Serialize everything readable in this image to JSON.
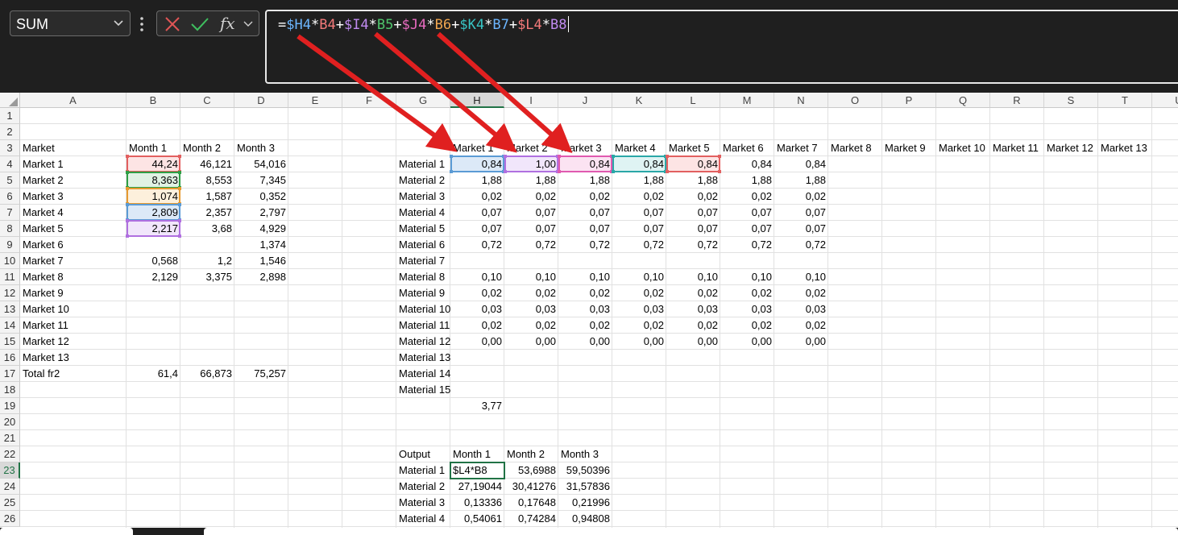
{
  "name_box": {
    "value": "SUM"
  },
  "formula_bar": {
    "fx_label": "fx",
    "tokens": [
      {
        "text": "=",
        "color": "#ffffff"
      },
      {
        "text": "$H4",
        "color": "#6cb6ff"
      },
      {
        "text": "*",
        "color": "#ffffff"
      },
      {
        "text": "B4",
        "color": "#f47a7a"
      },
      {
        "text": "+",
        "color": "#ffffff"
      },
      {
        "text": "$I4",
        "color": "#c08bf0"
      },
      {
        "text": "*",
        "color": "#ffffff"
      },
      {
        "text": "B5",
        "color": "#4fc66c"
      },
      {
        "text": "+",
        "color": "#ffffff"
      },
      {
        "text": "$J4",
        "color": "#e86bc0"
      },
      {
        "text": "*",
        "color": "#ffffff"
      },
      {
        "text": "B6",
        "color": "#f0a650"
      },
      {
        "text": "+",
        "color": "#ffffff"
      },
      {
        "text": "$K4",
        "color": "#38c4c4"
      },
      {
        "text": "*",
        "color": "#ffffff"
      },
      {
        "text": "B7",
        "color": "#6cb6ff"
      },
      {
        "text": "+",
        "color": "#ffffff"
      },
      {
        "text": "$L4",
        "color": "#f47a7a"
      },
      {
        "text": "*",
        "color": "#ffffff"
      },
      {
        "text": "B8",
        "color": "#c08bf0"
      }
    ]
  },
  "columns": [
    "A",
    "B",
    "C",
    "D",
    "E",
    "F",
    "G",
    "H",
    "I",
    "J",
    "K",
    "L",
    "M",
    "N",
    "O",
    "P",
    "Q",
    "R",
    "S",
    "T",
    "U"
  ],
  "selected_column": "H",
  "selected_row": 23,
  "rows": [
    "1",
    "2",
    "3",
    "4",
    "5",
    "6",
    "7",
    "8",
    "9",
    "10",
    "11",
    "12",
    "13",
    "14",
    "15",
    "16",
    "17",
    "18",
    "19",
    "20",
    "21",
    "22",
    "23",
    "24",
    "25",
    "26"
  ],
  "cells": [
    {
      "ref": "A3",
      "text": "Market"
    },
    {
      "ref": "B3",
      "text": "Month 1"
    },
    {
      "ref": "C3",
      "text": "Month 2"
    },
    {
      "ref": "D3",
      "text": "Month 3"
    },
    {
      "ref": "A4",
      "text": "Market 1"
    },
    {
      "ref": "B4",
      "text": "44,24",
      "num": true
    },
    {
      "ref": "C4",
      "text": "46,121",
      "num": true
    },
    {
      "ref": "D4",
      "text": "54,016",
      "num": true
    },
    {
      "ref": "A5",
      "text": "Market 2"
    },
    {
      "ref": "B5",
      "text": "8,363",
      "num": true
    },
    {
      "ref": "C5",
      "text": "8,553",
      "num": true
    },
    {
      "ref": "D5",
      "text": "7,345",
      "num": true
    },
    {
      "ref": "A6",
      "text": "Market 3"
    },
    {
      "ref": "B6",
      "text": "1,074",
      "num": true
    },
    {
      "ref": "C6",
      "text": "1,587",
      "num": true
    },
    {
      "ref": "D6",
      "text": "0,352",
      "num": true
    },
    {
      "ref": "A7",
      "text": "Market 4"
    },
    {
      "ref": "B7",
      "text": "2,809",
      "num": true
    },
    {
      "ref": "C7",
      "text": "2,357",
      "num": true
    },
    {
      "ref": "D7",
      "text": "2,797",
      "num": true
    },
    {
      "ref": "A8",
      "text": "Market 5"
    },
    {
      "ref": "B8",
      "text": "2,217",
      "num": true
    },
    {
      "ref": "C8",
      "text": "3,68",
      "num": true
    },
    {
      "ref": "D8",
      "text": "4,929",
      "num": true
    },
    {
      "ref": "A9",
      "text": "Market 6"
    },
    {
      "ref": "D9",
      "text": "1,374",
      "num": true
    },
    {
      "ref": "A10",
      "text": "Market 7"
    },
    {
      "ref": "B10",
      "text": "0,568",
      "num": true
    },
    {
      "ref": "C10",
      "text": "1,2",
      "num": true
    },
    {
      "ref": "D10",
      "text": "1,546",
      "num": true
    },
    {
      "ref": "A11",
      "text": "Market 8"
    },
    {
      "ref": "B11",
      "text": "2,129",
      "num": true
    },
    {
      "ref": "C11",
      "text": "3,375",
      "num": true
    },
    {
      "ref": "D11",
      "text": "2,898",
      "num": true
    },
    {
      "ref": "A12",
      "text": "Market 9"
    },
    {
      "ref": "A13",
      "text": "Market 10"
    },
    {
      "ref": "A14",
      "text": "Market 11"
    },
    {
      "ref": "A15",
      "text": "Market 12"
    },
    {
      "ref": "A16",
      "text": "Market 13"
    },
    {
      "ref": "A17",
      "text": "Total fr2"
    },
    {
      "ref": "B17",
      "text": "61,4",
      "num": true
    },
    {
      "ref": "C17",
      "text": "66,873",
      "num": true
    },
    {
      "ref": "D17",
      "text": "75,257",
      "num": true
    },
    {
      "ref": "H3",
      "text": "Market 1"
    },
    {
      "ref": "I3",
      "text": "Market 2"
    },
    {
      "ref": "J3",
      "text": "Market 3"
    },
    {
      "ref": "K3",
      "text": "Market 4"
    },
    {
      "ref": "L3",
      "text": "Market 5"
    },
    {
      "ref": "M3",
      "text": "Market 6"
    },
    {
      "ref": "N3",
      "text": "Market 7"
    },
    {
      "ref": "O3",
      "text": "Market 8"
    },
    {
      "ref": "P3",
      "text": "Market 9"
    },
    {
      "ref": "Q3",
      "text": "Market 10"
    },
    {
      "ref": "R3",
      "text": "Market 11"
    },
    {
      "ref": "S3",
      "text": "Market 12"
    },
    {
      "ref": "T3",
      "text": "Market 13"
    },
    {
      "ref": "G4",
      "text": "Material 1"
    },
    {
      "ref": "H4",
      "text": "0,84",
      "num": true
    },
    {
      "ref": "I4",
      "text": "1,00",
      "num": true
    },
    {
      "ref": "J4",
      "text": "0,84",
      "num": true
    },
    {
      "ref": "K4",
      "text": "0,84",
      "num": true
    },
    {
      "ref": "L4",
      "text": "0,84",
      "num": true
    },
    {
      "ref": "M4",
      "text": "0,84",
      "num": true
    },
    {
      "ref": "N4",
      "text": "0,84",
      "num": true
    },
    {
      "ref": "G5",
      "text": "Material 2"
    },
    {
      "ref": "H5",
      "text": "1,88",
      "num": true
    },
    {
      "ref": "I5",
      "text": "1,88",
      "num": true
    },
    {
      "ref": "J5",
      "text": "1,88",
      "num": true
    },
    {
      "ref": "K5",
      "text": "1,88",
      "num": true
    },
    {
      "ref": "L5",
      "text": "1,88",
      "num": true
    },
    {
      "ref": "M5",
      "text": "1,88",
      "num": true
    },
    {
      "ref": "N5",
      "text": "1,88",
      "num": true
    },
    {
      "ref": "G6",
      "text": "Material 3"
    },
    {
      "ref": "H6",
      "text": "0,02",
      "num": true
    },
    {
      "ref": "I6",
      "text": "0,02",
      "num": true
    },
    {
      "ref": "J6",
      "text": "0,02",
      "num": true
    },
    {
      "ref": "K6",
      "text": "0,02",
      "num": true
    },
    {
      "ref": "L6",
      "text": "0,02",
      "num": true
    },
    {
      "ref": "M6",
      "text": "0,02",
      "num": true
    },
    {
      "ref": "N6",
      "text": "0,02",
      "num": true
    },
    {
      "ref": "G7",
      "text": "Material 4"
    },
    {
      "ref": "H7",
      "text": "0,07",
      "num": true
    },
    {
      "ref": "I7",
      "text": "0,07",
      "num": true
    },
    {
      "ref": "J7",
      "text": "0,07",
      "num": true
    },
    {
      "ref": "K7",
      "text": "0,07",
      "num": true
    },
    {
      "ref": "L7",
      "text": "0,07",
      "num": true
    },
    {
      "ref": "M7",
      "text": "0,07",
      "num": true
    },
    {
      "ref": "N7",
      "text": "0,07",
      "num": true
    },
    {
      "ref": "G8",
      "text": "Material 5"
    },
    {
      "ref": "H8",
      "text": "0,07",
      "num": true
    },
    {
      "ref": "I8",
      "text": "0,07",
      "num": true
    },
    {
      "ref": "J8",
      "text": "0,07",
      "num": true
    },
    {
      "ref": "K8",
      "text": "0,07",
      "num": true
    },
    {
      "ref": "L8",
      "text": "0,07",
      "num": true
    },
    {
      "ref": "M8",
      "text": "0,07",
      "num": true
    },
    {
      "ref": "N8",
      "text": "0,07",
      "num": true
    },
    {
      "ref": "G9",
      "text": "Material 6"
    },
    {
      "ref": "H9",
      "text": "0,72",
      "num": true
    },
    {
      "ref": "I9",
      "text": "0,72",
      "num": true
    },
    {
      "ref": "J9",
      "text": "0,72",
      "num": true
    },
    {
      "ref": "K9",
      "text": "0,72",
      "num": true
    },
    {
      "ref": "L9",
      "text": "0,72",
      "num": true
    },
    {
      "ref": "M9",
      "text": "0,72",
      "num": true
    },
    {
      "ref": "N9",
      "text": "0,72",
      "num": true
    },
    {
      "ref": "G10",
      "text": "Material 7"
    },
    {
      "ref": "G11",
      "text": "Material 8"
    },
    {
      "ref": "H11",
      "text": "0,10",
      "num": true
    },
    {
      "ref": "I11",
      "text": "0,10",
      "num": true
    },
    {
      "ref": "J11",
      "text": "0,10",
      "num": true
    },
    {
      "ref": "K11",
      "text": "0,10",
      "num": true
    },
    {
      "ref": "L11",
      "text": "0,10",
      "num": true
    },
    {
      "ref": "M11",
      "text": "0,10",
      "num": true
    },
    {
      "ref": "N11",
      "text": "0,10",
      "num": true
    },
    {
      "ref": "G12",
      "text": "Material 9"
    },
    {
      "ref": "H12",
      "text": "0,02",
      "num": true
    },
    {
      "ref": "I12",
      "text": "0,02",
      "num": true
    },
    {
      "ref": "J12",
      "text": "0,02",
      "num": true
    },
    {
      "ref": "K12",
      "text": "0,02",
      "num": true
    },
    {
      "ref": "L12",
      "text": "0,02",
      "num": true
    },
    {
      "ref": "M12",
      "text": "0,02",
      "num": true
    },
    {
      "ref": "N12",
      "text": "0,02",
      "num": true
    },
    {
      "ref": "G13",
      "text": "Material 10"
    },
    {
      "ref": "H13",
      "text": "0,03",
      "num": true
    },
    {
      "ref": "I13",
      "text": "0,03",
      "num": true
    },
    {
      "ref": "J13",
      "text": "0,03",
      "num": true
    },
    {
      "ref": "K13",
      "text": "0,03",
      "num": true
    },
    {
      "ref": "L13",
      "text": "0,03",
      "num": true
    },
    {
      "ref": "M13",
      "text": "0,03",
      "num": true
    },
    {
      "ref": "N13",
      "text": "0,03",
      "num": true
    },
    {
      "ref": "G14",
      "text": "Material 11"
    },
    {
      "ref": "H14",
      "text": "0,02",
      "num": true
    },
    {
      "ref": "I14",
      "text": "0,02",
      "num": true
    },
    {
      "ref": "J14",
      "text": "0,02",
      "num": true
    },
    {
      "ref": "K14",
      "text": "0,02",
      "num": true
    },
    {
      "ref": "L14",
      "text": "0,02",
      "num": true
    },
    {
      "ref": "M14",
      "text": "0,02",
      "num": true
    },
    {
      "ref": "N14",
      "text": "0,02",
      "num": true
    },
    {
      "ref": "G15",
      "text": "Material 12"
    },
    {
      "ref": "H15",
      "text": "0,00",
      "num": true
    },
    {
      "ref": "I15",
      "text": "0,00",
      "num": true
    },
    {
      "ref": "J15",
      "text": "0,00",
      "num": true
    },
    {
      "ref": "K15",
      "text": "0,00",
      "num": true
    },
    {
      "ref": "L15",
      "text": "0,00",
      "num": true
    },
    {
      "ref": "M15",
      "text": "0,00",
      "num": true
    },
    {
      "ref": "N15",
      "text": "0,00",
      "num": true
    },
    {
      "ref": "G16",
      "text": "Material 13",
      "overflow": true
    },
    {
      "ref": "G17",
      "text": "Material 14",
      "overflow": true
    },
    {
      "ref": "G18",
      "text": "Material 15",
      "overflow": true
    },
    {
      "ref": "H19",
      "text": "3,77",
      "num": true
    },
    {
      "ref": "G22",
      "text": "Output"
    },
    {
      "ref": "H22",
      "text": "Month 1"
    },
    {
      "ref": "I22",
      "text": "Month 2"
    },
    {
      "ref": "J22",
      "text": "Month 3"
    },
    {
      "ref": "G23",
      "text": "Material 1"
    },
    {
      "ref": "H23",
      "text": "$L4*B8"
    },
    {
      "ref": "I23",
      "text": "53,6988",
      "num": true
    },
    {
      "ref": "J23",
      "text": "59,50396",
      "num": true
    },
    {
      "ref": "G24",
      "text": "Material 2"
    },
    {
      "ref": "H24",
      "text": "27,19044",
      "num": true
    },
    {
      "ref": "I24",
      "text": "30,41276",
      "num": true
    },
    {
      "ref": "J24",
      "text": "31,57836",
      "num": true
    },
    {
      "ref": "G25",
      "text": "Material 3"
    },
    {
      "ref": "H25",
      "text": "0,13336",
      "num": true
    },
    {
      "ref": "I25",
      "text": "0,17648",
      "num": true
    },
    {
      "ref": "J25",
      "text": "0,21996",
      "num": true
    },
    {
      "ref": "G26",
      "text": "Material 4"
    },
    {
      "ref": "H26",
      "text": "0,54061",
      "num": true
    },
    {
      "ref": "I26",
      "text": "0,74284",
      "num": true
    },
    {
      "ref": "J26",
      "text": "0,94808",
      "num": true
    }
  ],
  "highlights": [
    {
      "ref": "H4",
      "color": "#5b9bd5",
      "fill": "#dce9f7"
    },
    {
      "ref": "I4",
      "color": "#b070e0",
      "fill": "#f1e6fb"
    },
    {
      "ref": "J4",
      "color": "#e05ab0",
      "fill": "#fbe3f2"
    },
    {
      "ref": "K4",
      "color": "#2aa7a7",
      "fill": "#dff3f3"
    },
    {
      "ref": "L4",
      "color": "#e26060",
      "fill": "#fde4e4"
    },
    {
      "ref": "B4",
      "color": "#e26060",
      "fill": "#fde4e4"
    },
    {
      "ref": "B5",
      "color": "#2e9e44",
      "fill": "#e0f2e3"
    },
    {
      "ref": "B6",
      "color": "#e69a30",
      "fill": "#fdf0dc"
    },
    {
      "ref": "B7",
      "color": "#5b9bd5",
      "fill": "#dce9f7"
    },
    {
      "ref": "B8",
      "color": "#b070e0",
      "fill": "#f1e6fb"
    }
  ],
  "annotation_arrows": {
    "color": "#e02020"
  }
}
